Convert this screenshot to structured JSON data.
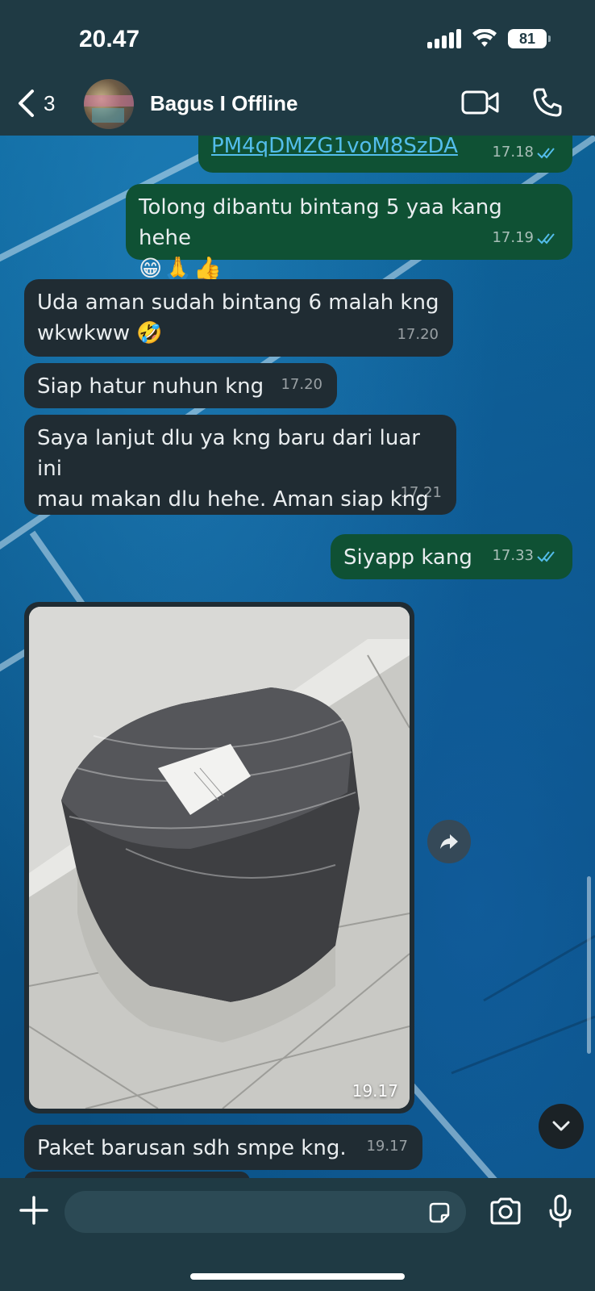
{
  "status_bar": {
    "time": "20.47",
    "battery": "81"
  },
  "header": {
    "back_count": "3",
    "contact_name": "Bagus I Offline"
  },
  "messages": [
    {
      "id": "m1",
      "direction": "out",
      "text": "PM4qDMZG1voM8SzDA",
      "time": "17.18",
      "is_link": true,
      "read": true
    },
    {
      "id": "m2",
      "direction": "out",
      "text": "Tolong dibantu bintang 5 yaa kang hehe",
      "emoji": "😁🙏👍",
      "time": "17.19",
      "read": true
    },
    {
      "id": "m3",
      "direction": "in",
      "text": "Uda aman sudah bintang 6 malah kng",
      "text2": "wkwkww 🤣",
      "time": "17.20"
    },
    {
      "id": "m4",
      "direction": "in",
      "text": "Siap hatur nuhun kng",
      "time": "17.20"
    },
    {
      "id": "m5",
      "direction": "in",
      "text": "Saya lanjut dlu ya kng baru dari luar ini",
      "text2": "mau makan dlu hehe. Aman siap kng",
      "time": "17.21"
    },
    {
      "id": "m6",
      "direction": "out",
      "text": "Siyapp kang",
      "time": "17.33",
      "read": true
    },
    {
      "id": "m7",
      "direction": "in",
      "type": "image",
      "time": "19.17"
    },
    {
      "id": "m8",
      "direction": "in",
      "text": "Paket barusan sdh smpe kng.",
      "time": "19.17"
    }
  ],
  "input": {
    "placeholder": ""
  },
  "colors": {
    "header": "#1f3a44",
    "bubble_out": "#0f5134",
    "bubble_in": "#202c33",
    "read_ticks": "#53bdeb"
  }
}
